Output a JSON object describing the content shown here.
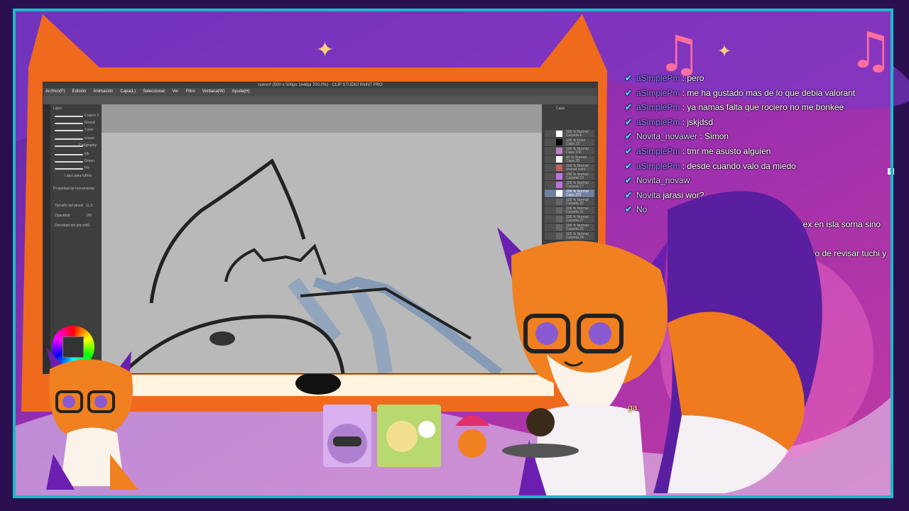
{
  "app": {
    "window_title": "nuevo* (500 x 500px 144dpi 700.0%) - CLIP STUDIO PAINT PRO",
    "menu": [
      "Archivo(F)",
      "Edición",
      "Animación",
      "Capa(L)",
      "Seleccionar",
      "Ver",
      "Filtro",
      "Ventana(W)",
      "Ayuda(H)"
    ],
    "brush_panel_title": "Lápiz",
    "brushes": [
      "Crayon 2",
      "Round",
      "Tuner",
      "eraser",
      "Calligraphy",
      "Ink",
      "Green",
      "Pin",
      "Lápiz para fuffets"
    ],
    "tool_property_title": "Propiedad de herramienta",
    "properties": [
      {
        "label": "Tamaño del pincel",
        "value": "11.5"
      },
      {
        "label": "Opacidad",
        "value": "100"
      },
      {
        "label": "Densidad del pincel",
        "value": "80"
      }
    ],
    "layers_panel_title": "Capa",
    "layers": [
      {
        "mode": "100 % Normal",
        "name": "Carpeta 4"
      },
      {
        "mode": "100 % Color",
        "name": "Capa 22"
      },
      {
        "mode": "100 % Normal",
        "name": "Capa 106"
      },
      {
        "mode": "40 % Normal",
        "name": "Capa 28"
      },
      {
        "mode": "100 % Normal",
        "name": "shared color - stable"
      },
      {
        "mode": "100 % Normal",
        "name": "Carpeta 19"
      },
      {
        "mode": "100 % Normal",
        "name": "Carpeta 17"
      },
      {
        "mode": "100 % Normal",
        "name": "Capa 201"
      },
      {
        "mode": "100 % Normal",
        "name": "Carpeta 32"
      },
      {
        "mode": "100 % Normal",
        "name": "Carpeta 31"
      },
      {
        "mode": "100 % Normal",
        "name": "Carpeta 27"
      },
      {
        "mode": "100 % Normal",
        "name": "Carpeta 25"
      },
      {
        "mode": "100 % Normal",
        "name": "Carpeta 24"
      }
    ],
    "colors": {
      "frame": "#1fb8c8",
      "canvas_bg": "#b9b9b9",
      "panel": "#3e3e3e"
    }
  },
  "chat": {
    "messages": [
      {
        "user": "aSimplePm",
        "text": ": pero",
        "user_style": "blue"
      },
      {
        "user": "aSimplePm",
        "text": ": me ha gustado mas de lo que debia valorant",
        "user_style": "blue"
      },
      {
        "user": "aSimplePm",
        "text": ": ya namas falta que rociero no me bonkee",
        "user_style": "blue"
      },
      {
        "user": "aSimplePm",
        "text": ": jskjdsd",
        "user_style": "blue"
      },
      {
        "user": "Novita_novawer",
        "text": ": Simon",
        "user_style": "light"
      },
      {
        "user": "aSimplePm",
        "text": ": tmr me asusto alguien",
        "user_style": "blue"
      },
      {
        "user": "aSimplePm",
        "text": ": desde cuando valo da miedo",
        "user_style": "blue"
      },
      {
        "user": "Novita_novaw",
        "text": "",
        "user_style": "light"
      },
      {
        "user": "Novita",
        "text": "jarasi wor?",
        "user_style": "light"
      },
      {
        "user": "No",
        "text": "",
        "user_style": "light"
      },
      {
        "user": "",
        "text": "distortus rex en isla sorna sino",
        "user_style": "light"
      },
      {
        "user": "",
        "text": "",
        "user_style": "light"
      },
      {
        "user": "",
        "text": "a creer, vengo de revisar tuchi y",
        "user_style": "light"
      }
    ],
    "bottom_text": "ga"
  }
}
